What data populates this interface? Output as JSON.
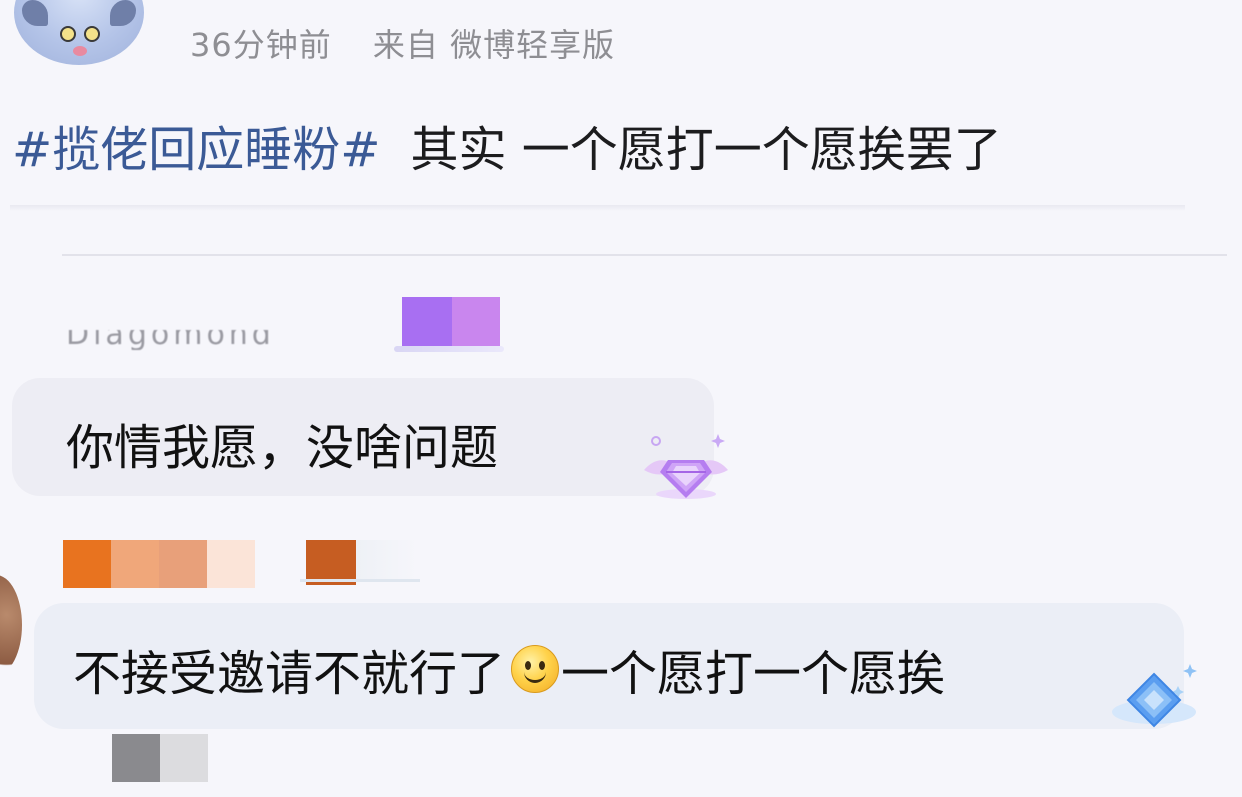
{
  "header": {
    "time_ago": "36分钟前",
    "source": "来自 微博轻享版"
  },
  "post": {
    "hashtag": "#揽佬回应睡粉#",
    "body": "其实 一个愿打一个愿挨罢了"
  },
  "comments": [
    {
      "username": "Diagomond",
      "text": "你情我愿，没啥问题"
    },
    {
      "text_before_emoji": "不接受邀请不就行了",
      "emoji": "smiley",
      "text_after_emoji": "一个愿打一个愿挨"
    }
  ],
  "icons": {
    "avatar": "cartoon-cat-avatar",
    "comment1_badge": "purple-diamond-fan-badge-icon",
    "comment2_badge": "blue-diamond-fan-badge-icon",
    "emoji": "smiley-face-icon"
  },
  "colors": {
    "hashtag": "#3b5a96",
    "meta": "#8e8e93",
    "bubble": "#ededf4",
    "name_redaction_purple": [
      "#a86ff2",
      "#c986ee"
    ],
    "name_redaction_orange": [
      "#e8731f",
      "#f0a77a",
      "#e8a07a",
      "#fbe4d8",
      "#c65d22"
    ],
    "name_redaction_gray": [
      "#8a8a8e",
      "#dcdcdf"
    ]
  }
}
